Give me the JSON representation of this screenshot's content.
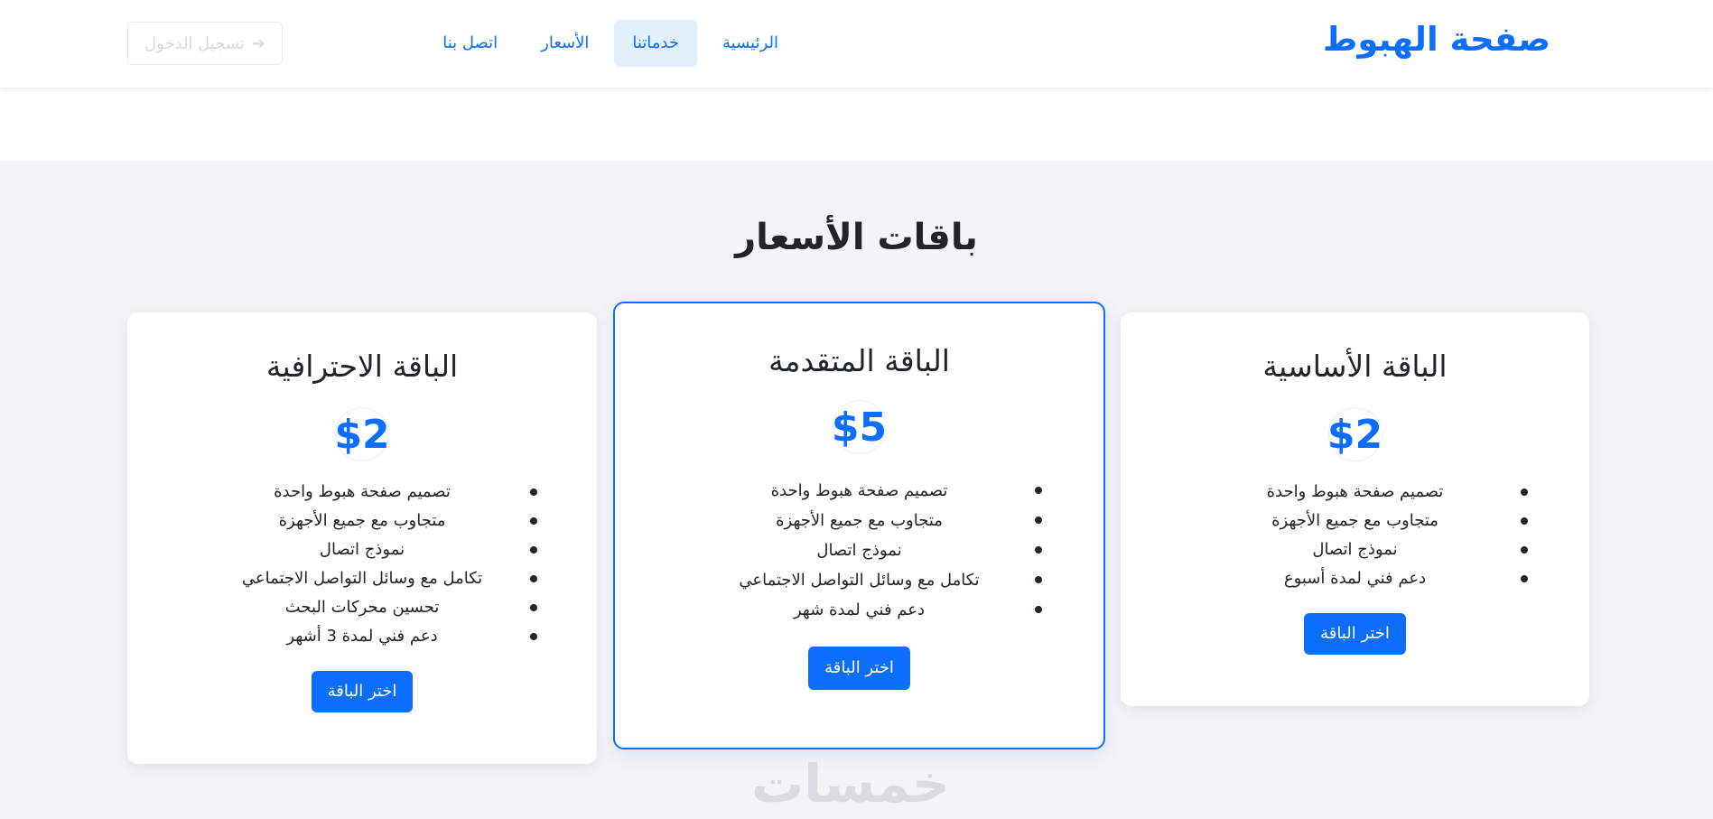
{
  "nav": {
    "brand": "صفحة الهبوط",
    "links": [
      {
        "label": "الرئيسية",
        "active": false
      },
      {
        "label": "خدماتنا",
        "active": true
      },
      {
        "label": "الأسعار",
        "active": false
      },
      {
        "label": "اتصل بنا",
        "active": false
      }
    ],
    "login_label": "تسجيل الدخول",
    "login_icon": "sign-in-icon"
  },
  "pricing": {
    "title": "باقات الأسعار",
    "plans": [
      {
        "name": "الباقة الأساسية",
        "price": "$2",
        "featured": false,
        "features": [
          "تصميم صفحة هبوط واحدة",
          "متجاوب مع جميع الأجهزة",
          "نموذج اتصال",
          "دعم فني لمدة أسبوع"
        ],
        "button": "اختر الباقة"
      },
      {
        "name": "الباقة المتقدمة",
        "price": "$5",
        "featured": true,
        "features": [
          "تصميم صفحة هبوط واحدة",
          "متجاوب مع جميع الأجهزة",
          "نموذج اتصال",
          "تكامل مع وسائل التواصل الاجتماعي",
          "دعم فني لمدة شهر"
        ],
        "button": "اختر الباقة"
      },
      {
        "name": "الباقة الاحترافية",
        "price": "$2",
        "featured": false,
        "features": [
          "تصميم صفحة هبوط واحدة",
          "متجاوب مع جميع الأجهزة",
          "نموذج اتصال",
          "تكامل مع وسائل التواصل الاجتماعي",
          "تحسين محركات البحث",
          "دعم فني لمدة 3 أشهر"
        ],
        "button": "اختر الباقة"
      }
    ]
  },
  "watermark": "خمسات",
  "colors": {
    "accent": "#0d6efd",
    "active_nav_bg": "#e3f1fd",
    "section_bg": "#f3f4f6"
  }
}
